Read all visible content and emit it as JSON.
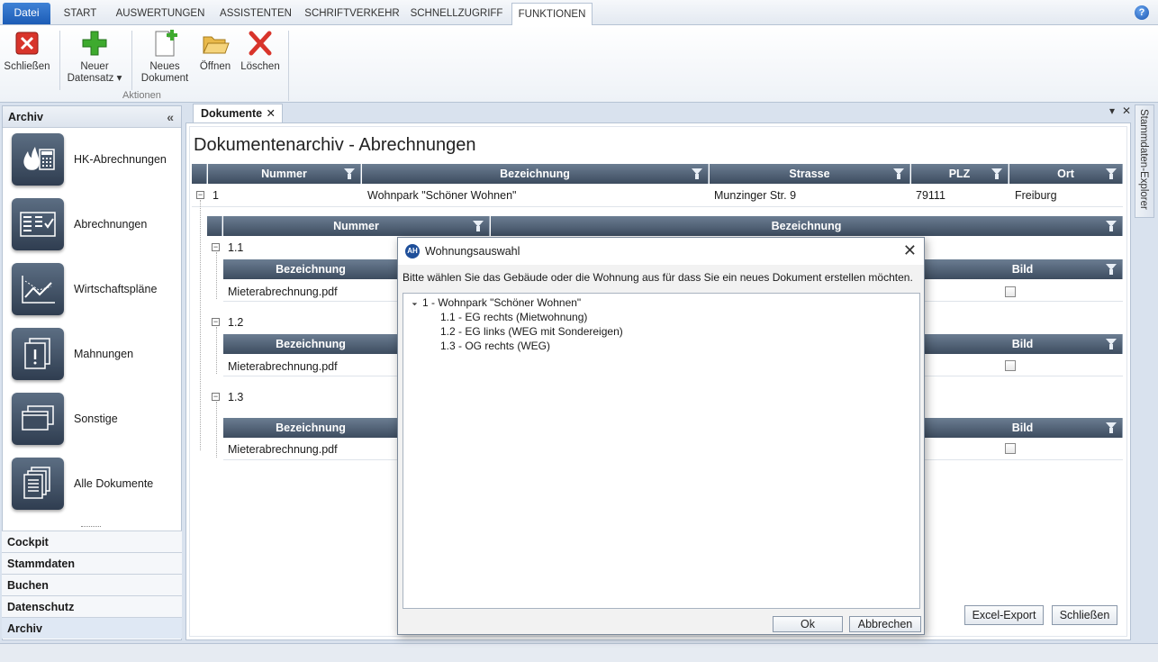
{
  "ribbon": {
    "file_tab": "Datei",
    "tabs": [
      "START",
      "AUSWERTUNGEN",
      "ASSISTENTEN",
      "SCHRIFTVERKEHR",
      "SCHNELLZUGRIFF",
      "FUNKTIONEN"
    ],
    "active_tab": "FUNKTIONEN",
    "buttons": {
      "close": "Schließen",
      "new_record_1": "Neuer",
      "new_record_2": "Datensatz ▾",
      "new_doc_1": "Neues",
      "new_doc_2": "Dokument",
      "open": "Öffnen",
      "delete": "Löschen"
    },
    "group_label": "Aktionen"
  },
  "sidebar": {
    "title": "Archiv",
    "items": [
      {
        "label": "HK-Abrechnungen",
        "icon": "flame-calculator-icon"
      },
      {
        "label": "Abrechnungen",
        "icon": "invoice-list-icon"
      },
      {
        "label": "Wirtschaftspläne",
        "icon": "chart-trend-icon"
      },
      {
        "label": "Mahnungen",
        "icon": "warning-document-icon"
      },
      {
        "label": "Sonstige",
        "icon": "windows-stack-icon"
      },
      {
        "label": "Alle Dokumente",
        "icon": "documents-stack-icon"
      }
    ],
    "sections": [
      "Cockpit",
      "Stammdaten",
      "Buchen",
      "Datenschutz",
      "Archiv"
    ],
    "active_section": "Archiv"
  },
  "document": {
    "tab_label": "Dokumente",
    "title": "Dokumentenarchiv - Abrechnungen",
    "grid": {
      "columns": [
        "Nummer",
        "Bezeichnung",
        "Strasse",
        "PLZ",
        "Ort"
      ],
      "row": {
        "nummer": "1",
        "bezeichnung": "Wohnpark \"Schöner Wohnen\"",
        "strasse": "Munzinger Str. 9",
        "plz": "79111",
        "ort": "Freiburg"
      }
    },
    "subgrid": {
      "columns": [
        "Nummer",
        "Bezeichnung"
      ],
      "units": [
        {
          "nummer": "1.1",
          "doc_col": "Bezeichnung",
          "img_col": "Bild",
          "file": "Mieterabrechnung.pdf"
        },
        {
          "nummer": "1.2",
          "doc_col": "Bezeichnung",
          "img_col": "Bild",
          "file": "Mieterabrechnung.pdf"
        },
        {
          "nummer": "1.3",
          "doc_col": "Bezeichnung",
          "img_col": "Bild",
          "file": "Mieterabrechnung.pdf"
        }
      ]
    },
    "buttons": {
      "export": "Excel-Export",
      "close": "Schließen"
    }
  },
  "right_explorer": "Stammdaten-Explorer",
  "dialog": {
    "title": "Wohnungsauswahl",
    "message": "Bitte wählen Sie das Gebäude oder die Wohnung aus für dass Sie ein neues Dokument erstellen möchten.",
    "tree": {
      "root": "1 - Wohnpark \"Schöner Wohnen\"",
      "children": [
        "1.1 - EG rechts (Mietwohnung)",
        "1.2 - EG links (WEG mit Sondereigen)",
        "1.3 - OG rechts (WEG)"
      ]
    },
    "ok": "Ok",
    "cancel": "Abbrechen"
  }
}
